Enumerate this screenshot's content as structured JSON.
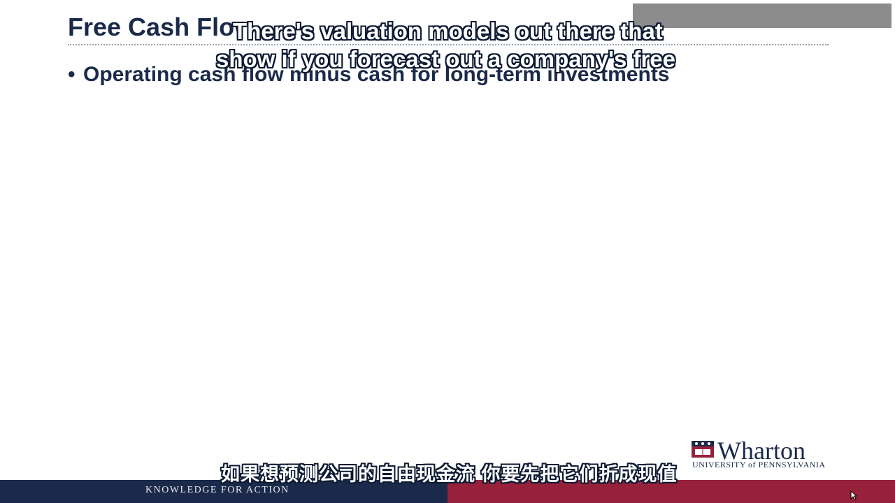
{
  "slide": {
    "title": "Free Cash Flow",
    "bullets": [
      "Operating cash flow minus cash for long-term investments"
    ]
  },
  "captions": {
    "english_line_1": "There's valuation models out there that",
    "english_line_2": "show if you forecast out a company's free",
    "chinese": "如果想预测公司的自由现金流 你要先把它们折成现值"
  },
  "logo": {
    "name": "Wharton",
    "subtitle": "UNIVERSITY of PENNSYLVANIA",
    "icon": "penn-shield-icon"
  },
  "footer": {
    "tagline": "KNOWLEDGE FOR ACTION"
  },
  "colors": {
    "navy": "#1b2a4a",
    "crimson": "#97213a",
    "gray_box": "#8c8c8c"
  }
}
